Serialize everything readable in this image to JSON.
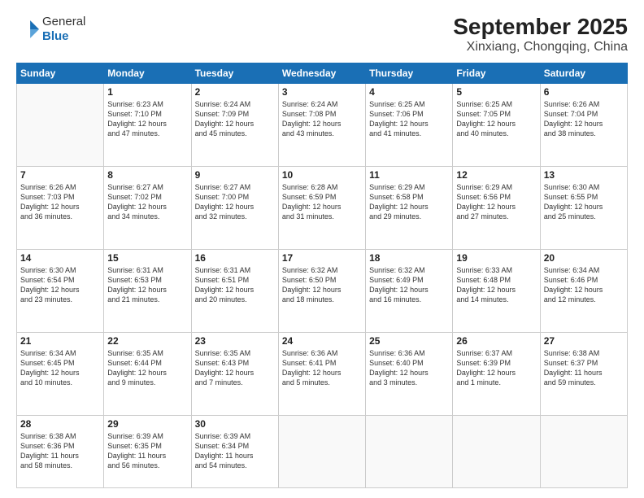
{
  "header": {
    "logo_line1": "General",
    "logo_line2": "Blue",
    "month": "September 2025",
    "location": "Xinxiang, Chongqing, China"
  },
  "weekdays": [
    "Sunday",
    "Monday",
    "Tuesday",
    "Wednesday",
    "Thursday",
    "Friday",
    "Saturday"
  ],
  "weeks": [
    [
      {
        "day": "",
        "info": ""
      },
      {
        "day": "1",
        "info": "Sunrise: 6:23 AM\nSunset: 7:10 PM\nDaylight: 12 hours\nand 47 minutes."
      },
      {
        "day": "2",
        "info": "Sunrise: 6:24 AM\nSunset: 7:09 PM\nDaylight: 12 hours\nand 45 minutes."
      },
      {
        "day": "3",
        "info": "Sunrise: 6:24 AM\nSunset: 7:08 PM\nDaylight: 12 hours\nand 43 minutes."
      },
      {
        "day": "4",
        "info": "Sunrise: 6:25 AM\nSunset: 7:06 PM\nDaylight: 12 hours\nand 41 minutes."
      },
      {
        "day": "5",
        "info": "Sunrise: 6:25 AM\nSunset: 7:05 PM\nDaylight: 12 hours\nand 40 minutes."
      },
      {
        "day": "6",
        "info": "Sunrise: 6:26 AM\nSunset: 7:04 PM\nDaylight: 12 hours\nand 38 minutes."
      }
    ],
    [
      {
        "day": "7",
        "info": "Sunrise: 6:26 AM\nSunset: 7:03 PM\nDaylight: 12 hours\nand 36 minutes."
      },
      {
        "day": "8",
        "info": "Sunrise: 6:27 AM\nSunset: 7:02 PM\nDaylight: 12 hours\nand 34 minutes."
      },
      {
        "day": "9",
        "info": "Sunrise: 6:27 AM\nSunset: 7:00 PM\nDaylight: 12 hours\nand 32 minutes."
      },
      {
        "day": "10",
        "info": "Sunrise: 6:28 AM\nSunset: 6:59 PM\nDaylight: 12 hours\nand 31 minutes."
      },
      {
        "day": "11",
        "info": "Sunrise: 6:29 AM\nSunset: 6:58 PM\nDaylight: 12 hours\nand 29 minutes."
      },
      {
        "day": "12",
        "info": "Sunrise: 6:29 AM\nSunset: 6:56 PM\nDaylight: 12 hours\nand 27 minutes."
      },
      {
        "day": "13",
        "info": "Sunrise: 6:30 AM\nSunset: 6:55 PM\nDaylight: 12 hours\nand 25 minutes."
      }
    ],
    [
      {
        "day": "14",
        "info": "Sunrise: 6:30 AM\nSunset: 6:54 PM\nDaylight: 12 hours\nand 23 minutes."
      },
      {
        "day": "15",
        "info": "Sunrise: 6:31 AM\nSunset: 6:53 PM\nDaylight: 12 hours\nand 21 minutes."
      },
      {
        "day": "16",
        "info": "Sunrise: 6:31 AM\nSunset: 6:51 PM\nDaylight: 12 hours\nand 20 minutes."
      },
      {
        "day": "17",
        "info": "Sunrise: 6:32 AM\nSunset: 6:50 PM\nDaylight: 12 hours\nand 18 minutes."
      },
      {
        "day": "18",
        "info": "Sunrise: 6:32 AM\nSunset: 6:49 PM\nDaylight: 12 hours\nand 16 minutes."
      },
      {
        "day": "19",
        "info": "Sunrise: 6:33 AM\nSunset: 6:48 PM\nDaylight: 12 hours\nand 14 minutes."
      },
      {
        "day": "20",
        "info": "Sunrise: 6:34 AM\nSunset: 6:46 PM\nDaylight: 12 hours\nand 12 minutes."
      }
    ],
    [
      {
        "day": "21",
        "info": "Sunrise: 6:34 AM\nSunset: 6:45 PM\nDaylight: 12 hours\nand 10 minutes."
      },
      {
        "day": "22",
        "info": "Sunrise: 6:35 AM\nSunset: 6:44 PM\nDaylight: 12 hours\nand 9 minutes."
      },
      {
        "day": "23",
        "info": "Sunrise: 6:35 AM\nSunset: 6:43 PM\nDaylight: 12 hours\nand 7 minutes."
      },
      {
        "day": "24",
        "info": "Sunrise: 6:36 AM\nSunset: 6:41 PM\nDaylight: 12 hours\nand 5 minutes."
      },
      {
        "day": "25",
        "info": "Sunrise: 6:36 AM\nSunset: 6:40 PM\nDaylight: 12 hours\nand 3 minutes."
      },
      {
        "day": "26",
        "info": "Sunrise: 6:37 AM\nSunset: 6:39 PM\nDaylight: 12 hours\nand 1 minute."
      },
      {
        "day": "27",
        "info": "Sunrise: 6:38 AM\nSunset: 6:37 PM\nDaylight: 11 hours\nand 59 minutes."
      }
    ],
    [
      {
        "day": "28",
        "info": "Sunrise: 6:38 AM\nSunset: 6:36 PM\nDaylight: 11 hours\nand 58 minutes."
      },
      {
        "day": "29",
        "info": "Sunrise: 6:39 AM\nSunset: 6:35 PM\nDaylight: 11 hours\nand 56 minutes."
      },
      {
        "day": "30",
        "info": "Sunrise: 6:39 AM\nSunset: 6:34 PM\nDaylight: 11 hours\nand 54 minutes."
      },
      {
        "day": "",
        "info": ""
      },
      {
        "day": "",
        "info": ""
      },
      {
        "day": "",
        "info": ""
      },
      {
        "day": "",
        "info": ""
      }
    ]
  ]
}
